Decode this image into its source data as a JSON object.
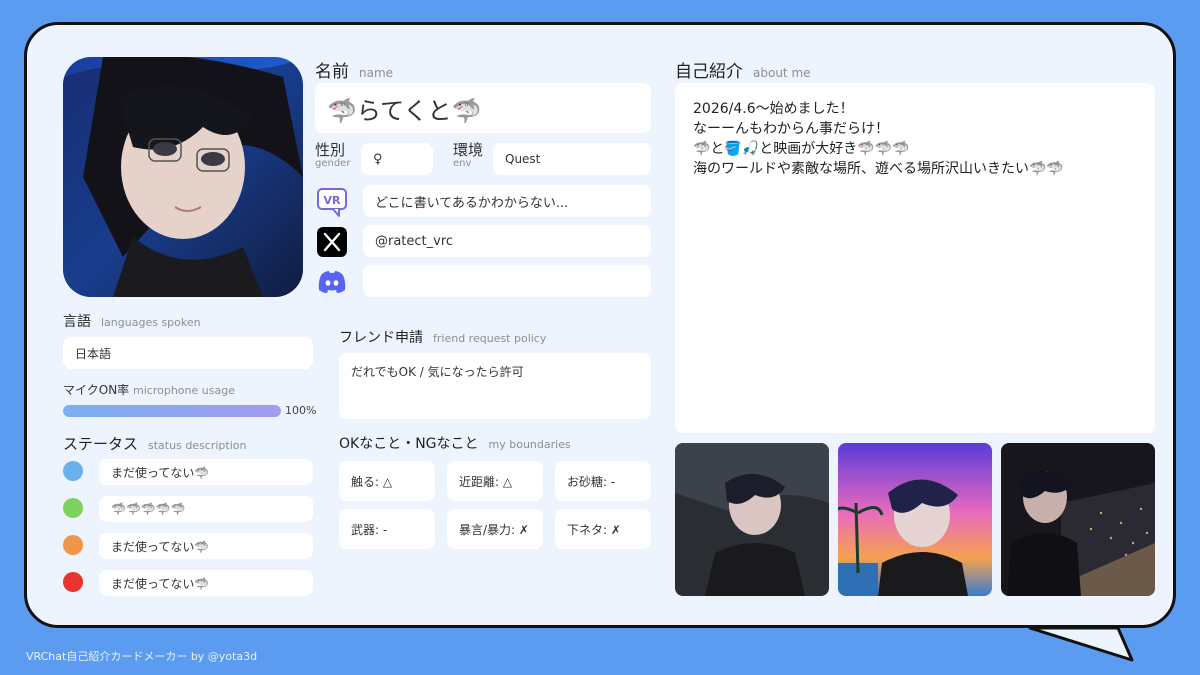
{
  "profile": {
    "name_label": "名前",
    "name_sub": "name",
    "name_value": "🦈らてくと🦈",
    "gender_label": "性別",
    "gender_sub": "gender",
    "gender_value": "♀",
    "env_label": "環境",
    "env_sub": "env",
    "env_value": "Quest",
    "vrchat_value": "どこに書いてあるかわからない...",
    "x_value": "@ratect_vrc",
    "discord_value": ""
  },
  "languages": {
    "label": "言語",
    "sub": "languages spoken",
    "value": "日本語"
  },
  "mic": {
    "label": "マイクON率",
    "sub": "microphone usage",
    "percent_text": "100%",
    "fraction": 1.0
  },
  "status": {
    "label": "ステータス",
    "sub": "status description",
    "items": [
      {
        "color": "#6ab1ec",
        "text": "まだ使ってない🦈"
      },
      {
        "color": "#7fd25c",
        "text": "🦈🦈🦈🦈🦈"
      },
      {
        "color": "#f0954a",
        "text": "まだ使ってない🦈"
      },
      {
        "color": "#e8332f",
        "text": "まだ使ってない🦈"
      }
    ]
  },
  "friend": {
    "label": "フレンド申請",
    "sub": "friend request policy",
    "value": "だれでもOK / 気になったら許可"
  },
  "boundaries": {
    "label": "OKなこと・NGなこと",
    "sub": "my boundaries",
    "items": [
      "触る: △",
      "近距離: △",
      "お砂糖: -",
      "武器: -",
      "暴言/暴力: ✗",
      "下ネタ: ✗"
    ]
  },
  "about": {
    "label": "自己紹介",
    "sub": "about me",
    "lines": [
      "2026/4.6〜始めました！",
      "なーーんもわからん事だらけ！",
      "🦈と🪣🎣と映画が大好き🦈🦈🦈",
      "海のワールドや素敵な場所、遊べる場所沢山いきたい🦈🦈"
    ]
  },
  "footer": "VRChat自己紹介カードメーカー by @yota3d",
  "icons": {
    "vrchat": "vrchat-icon",
    "x": "x-logo-icon",
    "discord": "discord-icon"
  },
  "colors": {
    "background": "#5b9bf0",
    "card": "#edf4fe",
    "accent": "#a49bef"
  }
}
